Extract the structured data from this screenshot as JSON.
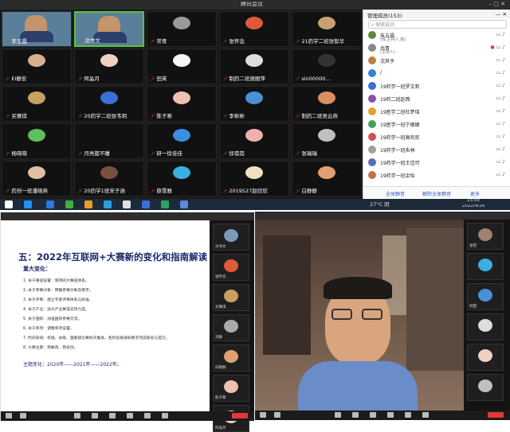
{
  "top": {
    "window_title": "腾讯会议",
    "gallery": [
      {
        "name": "李玉霞",
        "type": "video",
        "mic": true
      },
      {
        "name": "沈书文",
        "type": "video-active",
        "mic": true
      },
      {
        "name": "常青",
        "type": "avatar",
        "color": "#999",
        "mic": true
      },
      {
        "name": "张怀念",
        "type": "avatar",
        "color": "#e05a3a",
        "mic": true
      },
      {
        "name": "21药学二班张智华",
        "type": "avatar",
        "color": "#c9a070",
        "mic": true
      },
      {
        "name": "EI静安",
        "type": "avatar",
        "color": "#d8b090",
        "mic": true
      },
      {
        "name": "阿晶月",
        "type": "avatar",
        "color": "#f0d0c0",
        "mic": true
      },
      {
        "name": "田芙",
        "type": "avatar",
        "color": "#f5f5f5",
        "mic": true
      },
      {
        "name": "制药二班谢丽萍",
        "type": "avatar",
        "color": "#ddd",
        "mic": true
      },
      {
        "name": "sin00000...",
        "type": "avatar",
        "color": "#333",
        "mic": true
      },
      {
        "name": "买赛琪",
        "type": "avatar",
        "color": "#c8a060",
        "mic": true
      },
      {
        "name": "20药学二班张韦玥",
        "type": "avatar",
        "color": "#3a6fd8",
        "mic": true
      },
      {
        "name": "陈子寒",
        "type": "avatar",
        "color": "#f0c0b0",
        "mic": true
      },
      {
        "name": "李彬彬",
        "type": "avatar",
        "color": "#4a90d8",
        "mic": true
      },
      {
        "name": "制药二班吴云燕",
        "type": "avatar",
        "color": "#d89060",
        "mic": true
      },
      {
        "name": "杨晓晓",
        "type": "avatar",
        "color": "#5cc05c",
        "mic": true
      },
      {
        "name": "月亮都不睡",
        "type": "avatar",
        "color": "#111",
        "mic": true
      },
      {
        "name": "研一徐佳佳",
        "type": "avatar",
        "color": "#3a8fe0",
        "mic": true
      },
      {
        "name": "徐蓓蓓",
        "type": "avatar",
        "color": "#f0b0b0",
        "mic": true
      },
      {
        "name": "张瑞瑞",
        "type": "avatar",
        "color": "#c0c0c0",
        "mic": true
      },
      {
        "name": "药剂一班潘晓燕",
        "type": "avatar",
        "color": "#e0c0a0",
        "mic": true
      },
      {
        "name": "20药学1班宋子涵",
        "type": "avatar",
        "color": "#7a5040",
        "mic": true
      },
      {
        "name": "薛雪雅",
        "type": "avatar",
        "color": "#3ab0e0",
        "mic": true
      },
      {
        "name": "2019527赵欣欣",
        "type": "avatar",
        "color": "#f0e0c0",
        "mic": true
      },
      {
        "name": "白静静",
        "type": "avatar",
        "color": "#e0a070",
        "mic": true
      }
    ],
    "participants_title": "管理成员(153)",
    "search_placeholder": "搜索成员",
    "participants": [
      {
        "name": "朱五福",
        "sub": "(我,主持人,我)",
        "color": "#5a8a3a"
      },
      {
        "name": "尚青",
        "sub": "(主持人)",
        "color": "#888",
        "red": true
      },
      {
        "name": "沈其予",
        "sub": "",
        "color": "#c08040"
      },
      {
        "name": "/",
        "sub": "",
        "color": "#3a80d8"
      },
      {
        "name": "19药学一班罗文莉",
        "sub": "",
        "color": "#3a70d0"
      },
      {
        "name": "19药二班赵燕",
        "sub": "",
        "color": "#8a50a0"
      },
      {
        "name": "19医学二班杜梦瑶",
        "sub": "",
        "color": "#e0a030"
      },
      {
        "name": "19医学一班宁娜娜",
        "sub": "",
        "color": "#40a060"
      },
      {
        "name": "19药学一班高欢欢",
        "sub": "",
        "color": "#d05050"
      },
      {
        "name": "19药学一班朱林",
        "sub": "",
        "color": "#a0a0a0"
      },
      {
        "name": "19药学一班王佳可",
        "sub": "",
        "color": "#5070c0"
      },
      {
        "name": "19药学一班余怡",
        "sub": "",
        "color": "#c07050"
      }
    ],
    "footer_buttons": [
      "全体静音",
      "解除全体静音",
      "更多"
    ],
    "tray_temp": "27°C 阴",
    "tray_time": "15:09",
    "tray_date": "2022/4/26"
  },
  "slide": {
    "title": "五：2022年互联网+大赛新的变化和指南解读",
    "subtitle": "重大变化：",
    "lines": [
      "1. 关于赛道设置：保持四大赛道体系。",
      "2. 关于参赛对象：明确参赛对象及要求。",
      "3. 关于评审：建立专家评审体系与标准。",
      "4. 关于产业：加大产业赛道支持力度。",
      "5. 关于国际：加强国际参赛交流。",
      "6. 关于奖项：调整奖项设置。",
      "7. 时间安排：校级、省级、国家级比赛依次推进，各阶段按通知要求完成报名与提交。",
      "8. 大赛主题：我敢闯、我会创。"
    ],
    "theme_line": "主题变化：2020年——2021年——2022年。"
  },
  "slide_thumbs": [
    {
      "name": "沈书文",
      "color": "#7a9ab8"
    },
    {
      "name": "张怀念",
      "color": "#e05a3a"
    },
    {
      "name": "买赛琪",
      "color": "#c8a060"
    },
    {
      "name": "刘静",
      "color": "#aaa"
    },
    {
      "name": "白静静",
      "color": "#e0a070"
    },
    {
      "name": "陈子寒",
      "color": "#f0c0b0"
    },
    {
      "name": "阿晶月",
      "color": "#f0d0c0"
    }
  ],
  "speaker_thumbs": [
    {
      "name": "张雪",
      "color": "#a08070"
    },
    {
      "name": "",
      "color": "#3ab0e0"
    },
    {
      "name": "阿甜",
      "color": "#4a90d8"
    },
    {
      "name": "",
      "color": "#ddd"
    },
    {
      "name": "",
      "color": "#f0d0c0"
    },
    {
      "name": "",
      "color": "#c0c0c0"
    }
  ]
}
